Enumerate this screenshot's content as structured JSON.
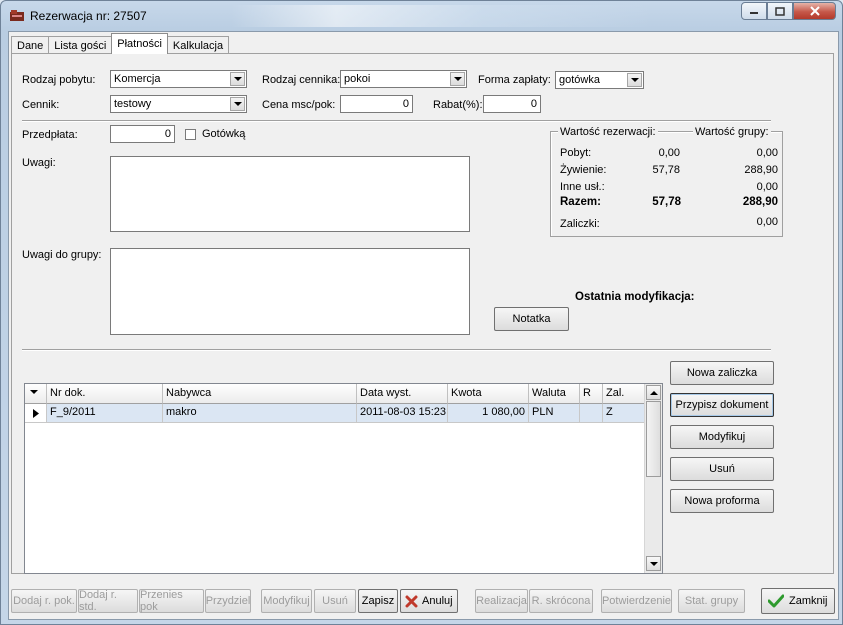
{
  "window": {
    "title": "Rezerwacja nr: 27507"
  },
  "tabs": [
    "Dane",
    "Lista gości",
    "Płatności",
    "Kalkulacja"
  ],
  "form": {
    "rodzaj_pobytu_label": "Rodzaj pobytu:",
    "rodzaj_pobytu_value": "Komercja",
    "rodzaj_cennika_label": "Rodzaj cennika:",
    "rodzaj_cennika_value": "pokoi",
    "forma_zaplaty_label": "Forma zapłaty:",
    "forma_zaplaty_value": "gotówka",
    "cennik_label": "Cennik:",
    "cennik_value": "testowy",
    "cena_label": "Cena msc/pok:",
    "cena_value": "0",
    "rabat_label": "Rabat(%):",
    "rabat_value": "0",
    "przedplata_label": "Przedpłata:",
    "przedplata_value": "0",
    "gotowka_label": "Gotówką",
    "uwagi_label": "Uwagi:",
    "uwagi_grupy_label": "Uwagi do grupy:",
    "ostatnia_mod_label": "Ostatnia modyfikacja:",
    "notatka_button": "Notatka"
  },
  "summary": {
    "rez_header": "Wartość rezerwacji:",
    "grp_header": "Wartość grupy:",
    "rows": [
      {
        "label": "Pobyt:",
        "rez": "0,00",
        "grp": "0,00"
      },
      {
        "label": "Żywienie:",
        "rez": "57,78",
        "grp": "288,90"
      },
      {
        "label": "Inne usł.:",
        "rez": "",
        "grp": "0,00"
      },
      {
        "label": "Razem:",
        "rez": "57,78",
        "grp": "288,90"
      },
      {
        "label": "Zaliczki:",
        "rez": "",
        "grp": "0,00"
      }
    ]
  },
  "grid": {
    "columns": [
      "Nr dok.",
      "Nabywca",
      "Data wyst.",
      "Kwota",
      "Waluta",
      "R",
      "Zal."
    ],
    "rows": [
      [
        "F_9/2011",
        "makro",
        "2011-08-03 15:23",
        "1 080,00",
        "PLN",
        "",
        "Z"
      ]
    ]
  },
  "side_buttons": [
    "Nowa zaliczka",
    "Przypisz dokument",
    "Modyfikuj",
    "Usuń",
    "Nowa proforma"
  ],
  "bottom_buttons": {
    "dodaj_pok": "Dodaj r. pok.",
    "dodaj_std": "Dodaj r. std.",
    "przenies": "Przenies pok",
    "przydziel": "Przydziel",
    "modyfikuj": "Modyfikuj",
    "usun": "Usuń",
    "zapisz": "Zapisz",
    "anuluj": "Anuluj",
    "realizacja": "Realizacja",
    "r_skrocona": "R. skrócona",
    "potwierdzenie": "Potwierdzenie",
    "stat_grupy": "Stat. grupy",
    "zamknij": "Zamknij"
  },
  "colors": {
    "accent_check": "#2e9a2e",
    "cancel_x": "#c0392b",
    "row_select": "#dbe6f3"
  }
}
